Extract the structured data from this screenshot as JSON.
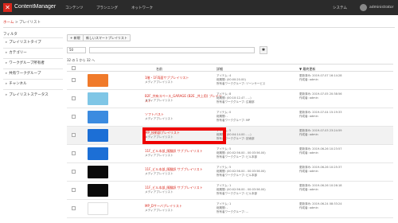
{
  "app": {
    "brand": "ContentManager",
    "brand_icon": "✕",
    "nav": [
      "コンテンツ",
      "プランニング",
      "ネットワーク"
    ],
    "system": "システム",
    "user": "administrator"
  },
  "breadcrumb": {
    "home": "ホーム",
    "sep": ">",
    "current": "プレイリスト"
  },
  "sidebar": {
    "title": "フィルタ",
    "items": [
      "プレイリストタイプ",
      "カテゴリー",
      "ワークグループ所有者",
      "共有ワークグループ",
      "チャンネル",
      "プレイリストステータス"
    ]
  },
  "toolbar": {
    "new": "+ 新規",
    "new_smart": "新しいスマートプレイリスト"
  },
  "list": {
    "page_size": "50",
    "search_icon": "gear-icon",
    "search_glyph": "✱",
    "count_text": "32 の 1 から 32 へ",
    "headers": {
      "name": "名前",
      "detail": "詳細",
      "updated": "▼ 最終更新"
    },
    "rows": [
      {
        "name": "1階・1F両面サブプレイリスト",
        "sub": "メディアプレイリスト",
        "thumb": "#f07a2a",
        "detail": [
          "アイテム: 4",
          "総期間: (00:00:20.00)",
          "所有者ワークグループ: ゾーンサービス"
        ],
        "date": [
          "更新済み: 2019-07-07 16:14:28",
          "作成者: admin"
        ],
        "hl": false
      },
      {
        "name": "B2F_共有スペース_GARAGE (B2E _共上用) プレイリスト",
        "sub": "メディアプレイリスト",
        "thumb": "#7fc6e6",
        "detail": [
          "アイテム: 8",
          "総期間: (00:10:12.47 - ...)",
          "所有者ワークグループ: 広報部"
        ],
        "date": [
          "更新済み: 2019-07-05 20:38:56",
          "作成者: admin"
        ],
        "hl": false
      },
      {
        "name": "ソフトバスト",
        "sub": "メディアプレイリスト",
        "thumb": "#3b8be0",
        "detail": [
          "アイテム: 0",
          "総期間: -",
          "所有者ワークグループ: MP"
        ],
        "date": [
          "更新済み: 2019-07-04 15:19:33",
          "作成者: admin"
        ],
        "hl": false
      },
      {
        "name": "MP_技術部プレイリスト",
        "sub": "メディアプレイリスト",
        "thumb": "#1c6fd6",
        "detail": [
          "アイテム: 5",
          "総期間: (00:04:14.00 - ...)",
          "所有者ワークグループ: 技術部"
        ],
        "date": [
          "更新済み: 2019-07-03 23:24:59",
          "作成者: admin"
        ],
        "hl": true
      },
      {
        "name": "11F_ビル本部_随翻訳 サブプレイリスト",
        "sub": "メディアプレイリスト",
        "thumb": "#1c6fd6",
        "detail": [
          "アイテム: 5",
          "総期間: (00:02:56.00 - 00:03:56.00)",
          "所有者ワークグループ: ビル本部"
        ],
        "date": [
          "更新済み: 2019-06-26 10:23:57",
          "作成者: admin"
        ],
        "hl": false
      },
      {
        "name": "11F_ビル本部_随翻訳 サブプレイリスト",
        "sub": "メディアプレイリスト",
        "thumb": "#0a0a0a",
        "detail": [
          "アイテム: 5",
          "総期間: (00:02:56.00 - 00:03:56.00)",
          "所有者ワークグループ: ビル本部"
        ],
        "date": [
          "更新済み: 2019-06-26 10:25:37",
          "作成者: admin"
        ],
        "hl": false
      },
      {
        "name": "11F_ビル本部_随翻訳 サブプレイリスト",
        "sub": "メディアプレイリスト",
        "thumb": "#0a0a0a",
        "detail": [
          "アイテム: 1",
          "総期間: (00:02:56.00 - 00:03:56.00)",
          "所有者ワークグループ: ビル本部"
        ],
        "date": [
          "更新済み: 2019-06-26 10:26:18",
          "作成者: admin"
        ],
        "hl": false
      },
      {
        "name": "MP_Dサーバプレイリスト",
        "sub": "メディアプレイリスト",
        "thumb": "#ffffff",
        "detail": [
          "アイテム: 1",
          "総期間: -",
          "所有者ワークグループ: ..."
        ],
        "date": [
          "更新済み: 2019-06-24 08:33:24",
          "作成者: admin"
        ],
        "hl": false
      }
    ]
  }
}
